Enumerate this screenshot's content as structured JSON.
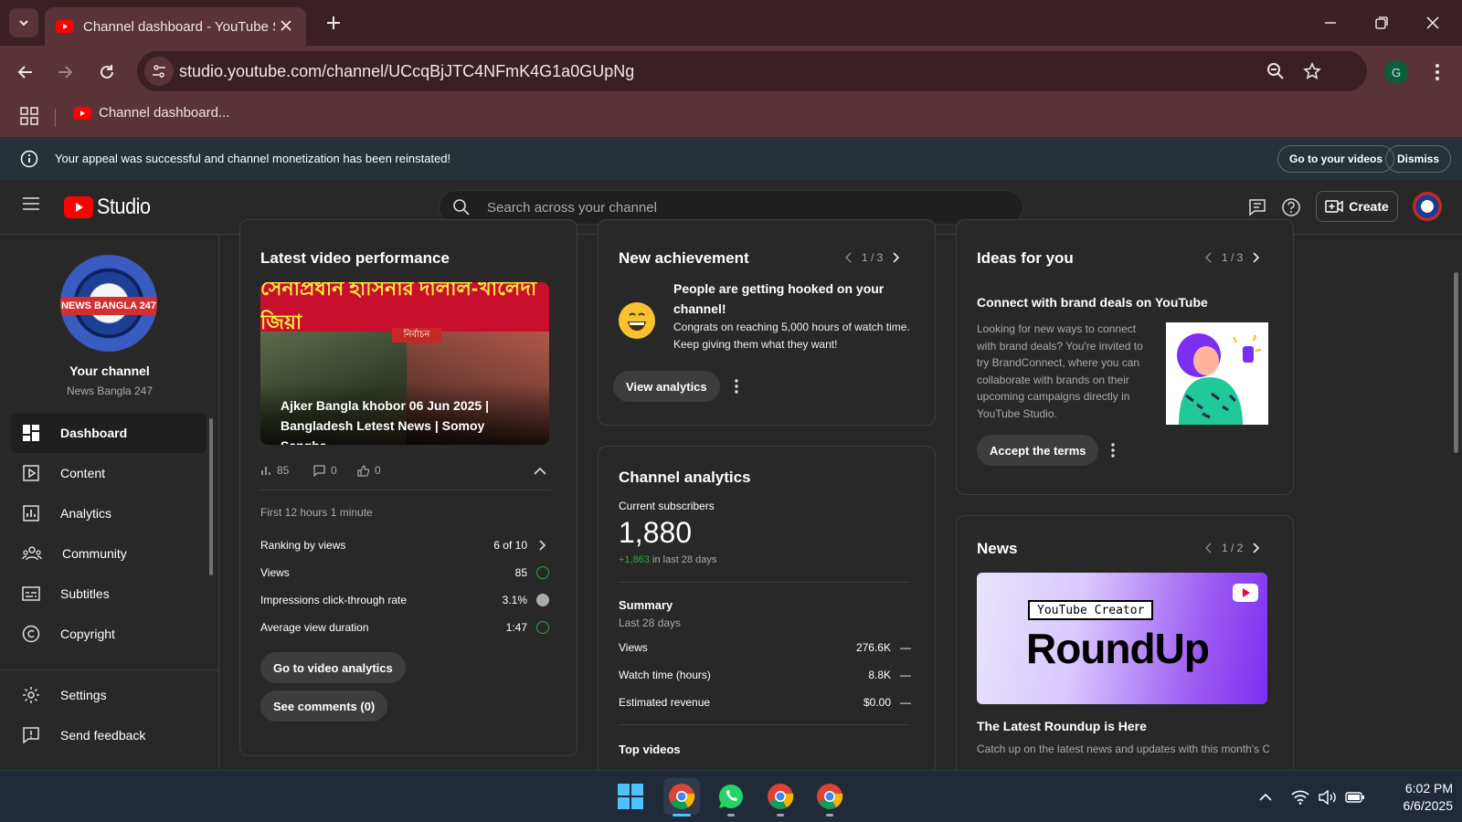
{
  "browser": {
    "tab_title": "Channel dashboard - YouTube Studio",
    "url": "studio.youtube.com/channel/UCcqBjJTC4NFmK4G1a0GUpNg",
    "profile_initial": "G",
    "bookmark_label": "Channel dashboard..."
  },
  "banner": {
    "message": "Your appeal was successful and channel monetization has been reinstated!",
    "go_to_videos": "Go to your videos",
    "dismiss": "Dismiss"
  },
  "header": {
    "logo_text": "Studio",
    "search_placeholder": "Search across your channel",
    "create_label": "Create"
  },
  "sidebar": {
    "avatar_band": "NEWS BANGLA 247",
    "your_channel": "Your channel",
    "channel_name": "News Bangla 247",
    "items": [
      {
        "label": "Dashboard"
      },
      {
        "label": "Content"
      },
      {
        "label": "Analytics"
      },
      {
        "label": "Community"
      },
      {
        "label": "Subtitles"
      },
      {
        "label": "Copyright"
      }
    ],
    "settings": "Settings",
    "feedback": "Send feedback"
  },
  "latest_video": {
    "title": "Latest video performance",
    "thumb_headline": "সেনাপ্রধান হাসিনার দালাল-খালেদা জিয়া",
    "thumb_tag": "নির্বাচন",
    "video_title": "Ajker Bangla khobor 06 Jun 2025 | Bangladesh Letest News | Somoy Sangba...",
    "views_count": "85",
    "comments_count": "0",
    "likes_count": "0",
    "period": "First 12 hours 1 minute",
    "rows": [
      {
        "label": "Ranking by views",
        "value": "6 of 10"
      },
      {
        "label": "Views",
        "value": "85"
      },
      {
        "label": "Impressions click-through rate",
        "value": "3.1%"
      },
      {
        "label": "Average view duration",
        "value": "1:47"
      }
    ],
    "btn_analytics": "Go to video analytics",
    "btn_comments": "See comments (0)"
  },
  "achievement": {
    "title": "New achievement",
    "pager": "1 / 3",
    "headline": "People are getting hooked on your channel!",
    "body": "Congrats on reaching 5,000 hours of watch time. Keep giving them what they want!",
    "btn": "View analytics"
  },
  "analytics": {
    "title": "Channel analytics",
    "subs_label": "Current subscribers",
    "subs_value": "1,880",
    "subs_delta": "+1,863",
    "subs_delta_suffix": "in last 28 days",
    "summary_title": "Summary",
    "summary_period": "Last 28 days",
    "rows": [
      {
        "label": "Views",
        "value": "276.6K"
      },
      {
        "label": "Watch time (hours)",
        "value": "8.8K"
      },
      {
        "label": "Estimated revenue",
        "value": "$0.00"
      }
    ],
    "dash": "—",
    "top_videos": "Top videos"
  },
  "ideas": {
    "title": "Ideas for you",
    "pager": "1 / 3",
    "headline": "Connect with brand deals on YouTube",
    "body": "Looking for new ways to connect with brand deals? You're invited to try BrandConnect, where you can collaborate with brands on their upcoming campaigns directly in YouTube Studio.",
    "btn": "Accept the terms"
  },
  "news": {
    "title": "News",
    "pager": "1 / 2",
    "img_badge": "YouTube Creator",
    "img_big": "RoundUp",
    "headline": "The Latest Roundup is Here",
    "body": "Catch up on the latest news and updates with this month's Creator Roundup."
  },
  "taskbar": {
    "time": "6:02 PM",
    "date": "6/6/2025"
  },
  "colors": {
    "accent_green": "#2ba640",
    "youtube_red": "#ff0000"
  }
}
